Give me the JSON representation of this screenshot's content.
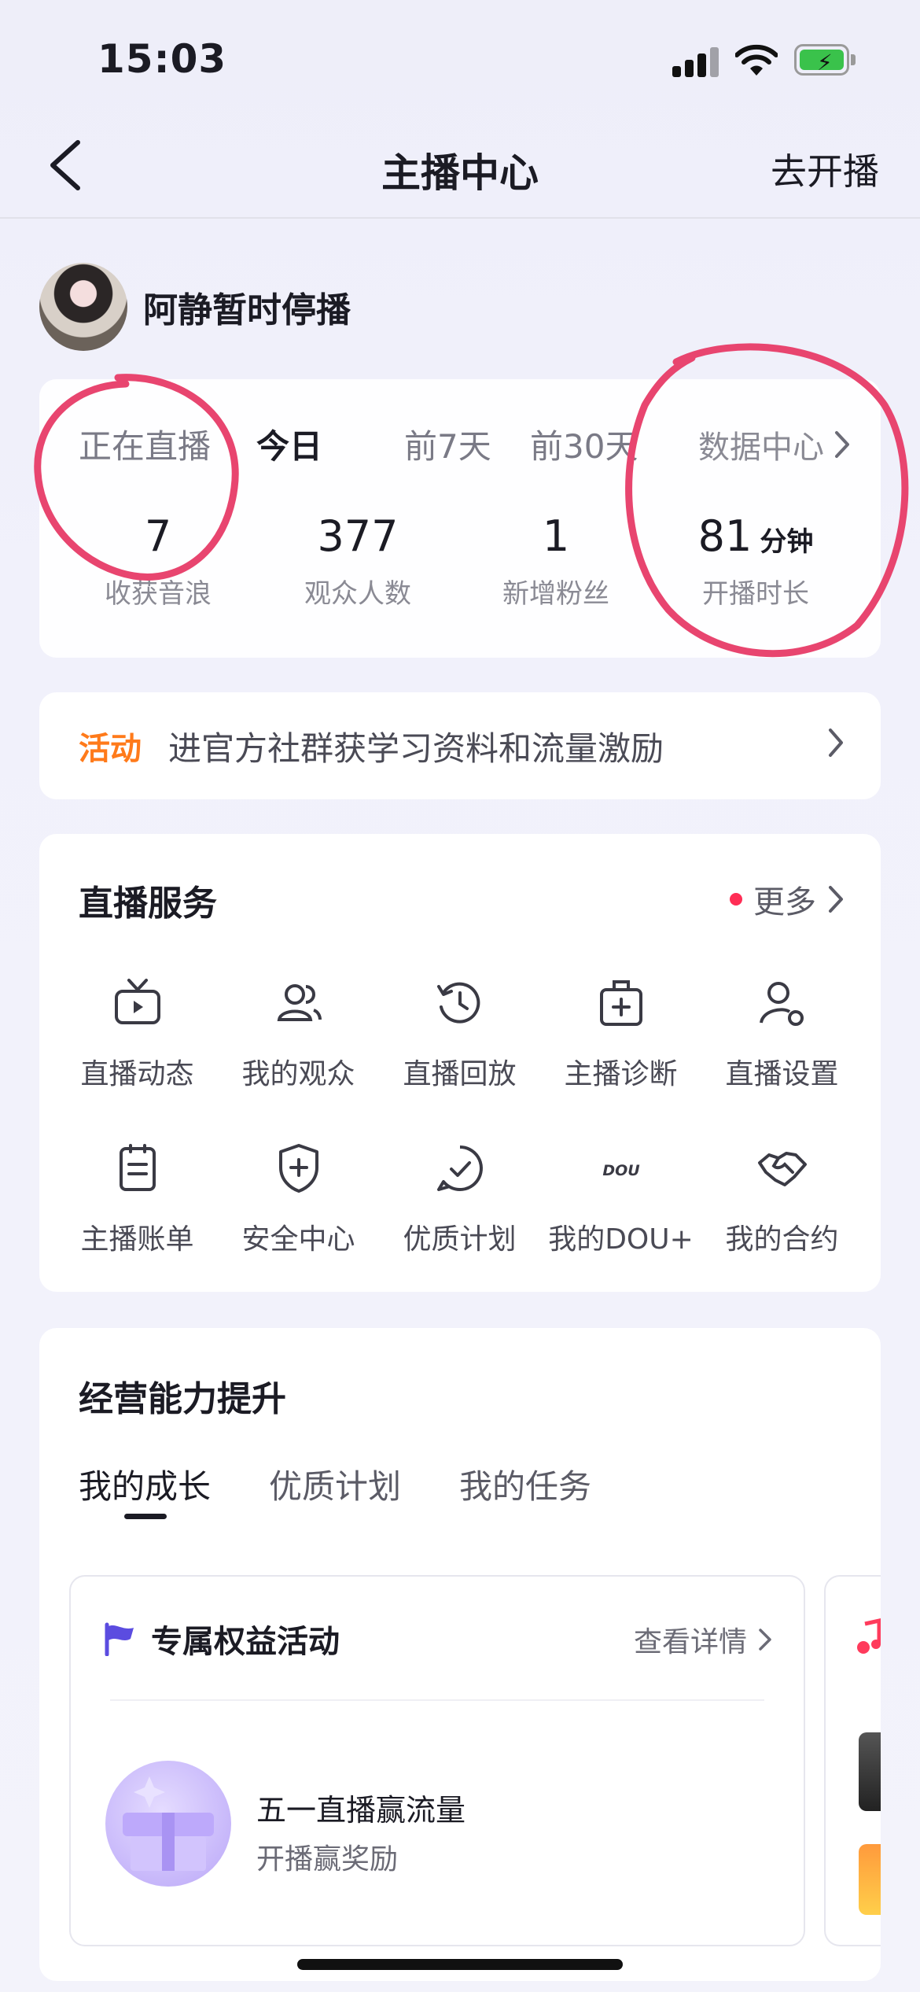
{
  "status_bar": {
    "time": "15:03"
  },
  "nav": {
    "title": "主播中心",
    "action": "去开播"
  },
  "profile": {
    "name": "阿静暂时停播"
  },
  "stats": {
    "tabs": [
      "正在直播",
      "今日",
      "前7天",
      "前30天"
    ],
    "active_tab": "今日",
    "data_center": "数据中心",
    "items": [
      {
        "value": "7",
        "label": "收获音浪"
      },
      {
        "value": "377",
        "label": "观众人数"
      },
      {
        "value": "1",
        "label": "新增粉丝"
      },
      {
        "value": "81",
        "unit": "分钟",
        "label": "开播时长"
      }
    ]
  },
  "activity": {
    "tag": "活动",
    "text": "进官方社群获学习资料和流量激励"
  },
  "services": {
    "title": "直播服务",
    "more": "更多",
    "items": [
      {
        "label": "直播动态",
        "icon": "tv-icon"
      },
      {
        "label": "我的观众",
        "icon": "audience-icon"
      },
      {
        "label": "直播回放",
        "icon": "replay-icon"
      },
      {
        "label": "主播诊断",
        "icon": "medical-kit-icon"
      },
      {
        "label": "直播设置",
        "icon": "user-settings-icon"
      },
      {
        "label": "主播账单",
        "icon": "bill-icon"
      },
      {
        "label": "安全中心",
        "icon": "shield-plus-icon"
      },
      {
        "label": "优质计划",
        "icon": "check-circle-icon"
      },
      {
        "label": "我的DOU+",
        "icon": "dou-plus-icon",
        "icon_text": "DOU"
      },
      {
        "label": "我的合约",
        "icon": "handshake-icon"
      }
    ]
  },
  "growth": {
    "title": "经营能力提升",
    "tabs": [
      "我的成长",
      "优质计划",
      "我的任务"
    ],
    "active_tab": "我的成长",
    "card": {
      "title": "专属权益活动",
      "more": "查看详情",
      "promo_title": "五一直播赢流量",
      "promo_sub": "开播赢奖励"
    }
  },
  "colors": {
    "accent_orange": "#ff7a1a",
    "annotation_pink": "#e8456f",
    "dot_red": "#ff2d55",
    "flag_purple": "#5b4ce0"
  }
}
